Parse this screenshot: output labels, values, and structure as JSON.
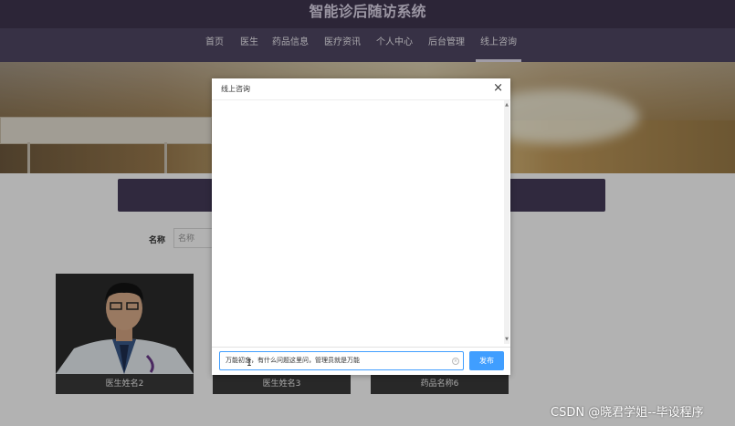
{
  "site": {
    "title": "智能诊后随访系统"
  },
  "nav": {
    "items": [
      {
        "label": "首页"
      },
      {
        "label": "医生"
      },
      {
        "label": "药品信息"
      },
      {
        "label": "医疗资讯"
      },
      {
        "label": "个人中心"
      },
      {
        "label": "后台管理"
      },
      {
        "label": "线上咨询"
      }
    ],
    "active": "线上咨询"
  },
  "search": {
    "label": "名称",
    "placeholder": "名称"
  },
  "cards": [
    {
      "caption": "医生姓名2"
    },
    {
      "caption": "医生姓名3"
    },
    {
      "caption": "药品名称6"
    }
  ],
  "dialog": {
    "title": "线上咨询",
    "close": "×",
    "input_value": "万能初恋，有什么问题这里问，管理员就是万能",
    "send_label": "发布"
  },
  "watermark": "CSDN @晓君学姐--毕设程序",
  "colors": {
    "header": "#3f3550",
    "nav": "#4f4763",
    "primary": "#409eff"
  }
}
